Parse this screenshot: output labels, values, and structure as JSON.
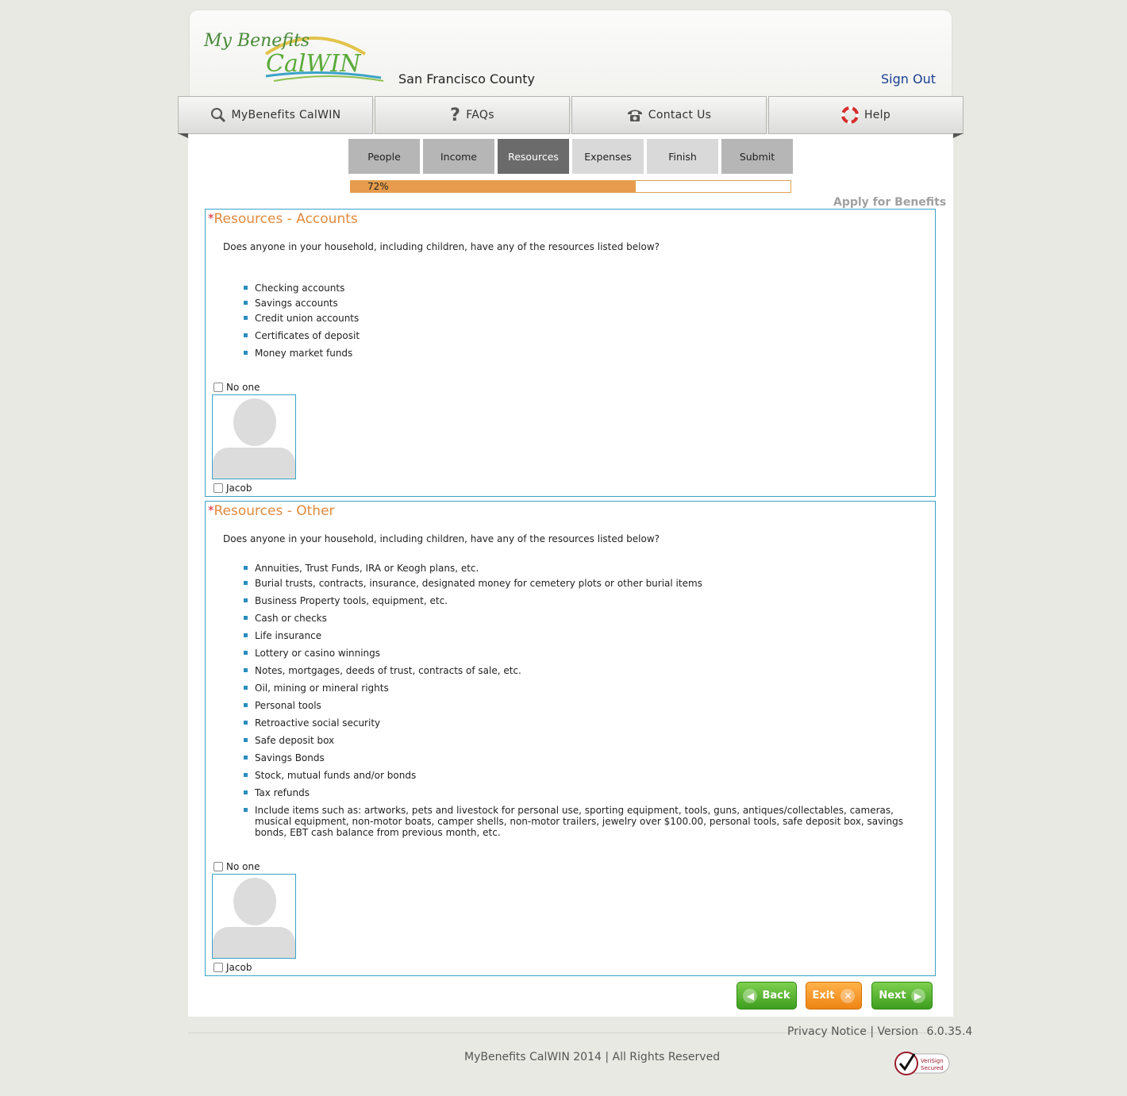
{
  "header": {
    "logo_text_top": "My Benefits",
    "logo_text_bottom": "CalWIN",
    "county": "San Francisco County",
    "sign_out": "Sign Out"
  },
  "topnav": {
    "items": [
      {
        "label": "MyBenefits CalWIN",
        "icon": "search-icon"
      },
      {
        "label": "FAQs",
        "icon": "question-icon"
      },
      {
        "label": "Contact Us",
        "icon": "phone-icon"
      },
      {
        "label": "Help",
        "icon": "lifebuoy-icon"
      }
    ]
  },
  "steps": {
    "items": [
      {
        "label": "People",
        "state": "done"
      },
      {
        "label": "Income",
        "state": "done"
      },
      {
        "label": "Resources",
        "state": "active"
      },
      {
        "label": "Expenses",
        "state": "todo"
      },
      {
        "label": "Finish",
        "state": "todo"
      },
      {
        "label": "Submit",
        "state": "done"
      }
    ]
  },
  "progress": {
    "value": 0.72,
    "label": "72%",
    "color": "#e69c4c"
  },
  "apply_label": "Apply for Benefits",
  "sections": [
    {
      "title": "Resources - Accounts",
      "required_mark": "*",
      "question": "Does anyone in your household, including children, have any of the resources listed below?",
      "items": [
        "Checking accounts",
        "Savings accounts",
        "Credit union accounts",
        "Certificates of deposit",
        "Money market funds"
      ],
      "no_one_label": "No one",
      "person": "Jacob"
    },
    {
      "title": "Resources - Other",
      "required_mark": "*",
      "question": "Does anyone in your household, including children, have any of the resources listed below?",
      "items": [
        "Annuities, Trust Funds, IRA or Keogh plans, etc.",
        "Burial trusts, contracts, insurance, designated money for cemetery plots or other burial items",
        "Business Property tools, equipment, etc.",
        "Cash or checks",
        "Life insurance",
        "Lottery or casino winnings",
        "Notes, mortgages, deeds of trust, contracts of sale, etc.",
        "Oil, mining or mineral rights",
        "Personal tools",
        "Retroactive social security",
        "Safe deposit box",
        "Savings Bonds",
        "Stock, mutual funds and/or bonds",
        "Tax refunds",
        "Include items such as: artworks, pets and livestock for personal use, sporting equipment, tools, guns, antiques/collectables, cameras, musical equipment, non-motor boats, camper shells, non-motor trailers, jewelry over $100.00, personal tools, safe deposit box, savings bonds, EBT cash balance from previous month, etc."
      ],
      "no_one_label": "No one",
      "person": "Jacob"
    }
  ],
  "buttons": {
    "back": "Back",
    "exit": "Exit",
    "next": "Next"
  },
  "footer": {
    "privacy": "Privacy Notice",
    "separator": "|",
    "version_label": "Version",
    "version": "6.0.35.4",
    "copyright": "MyBenefits CalWIN 2014 | All Rights Reserved",
    "seal_text_1": "VeriSign",
    "seal_text_2": "Secured"
  },
  "colors": {
    "accent_blue": "#3aa3c8",
    "title_orange": "#e08a3e",
    "button_green": "#3d9d1f",
    "button_orange": "#ee8414",
    "link_blue": "#1a3f8f"
  }
}
